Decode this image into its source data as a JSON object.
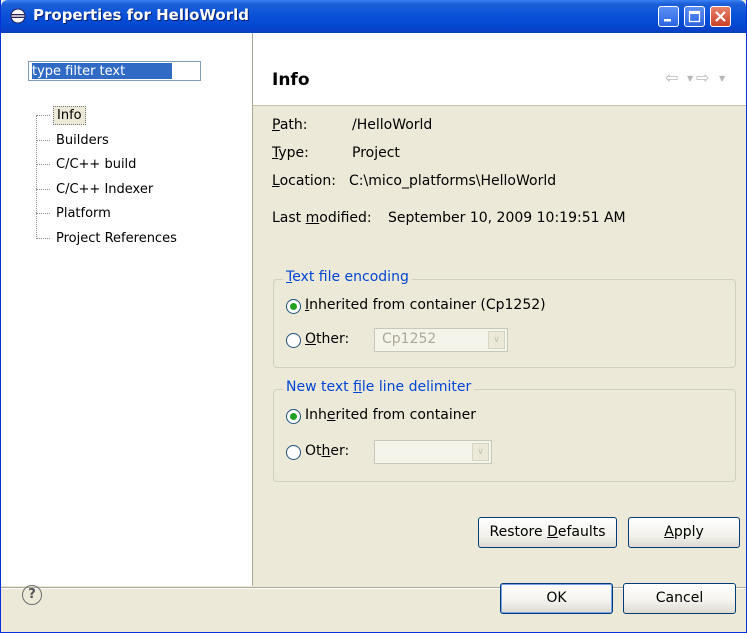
{
  "window": {
    "title": "Properties for HelloWorld",
    "title_icon": "eclipse-icon"
  },
  "sidebar": {
    "filter_value": "type filter text",
    "items": [
      {
        "label": "Info",
        "selected": true
      },
      {
        "label": "Builders"
      },
      {
        "label": "C/C++ build"
      },
      {
        "label": "C/C++ Indexer"
      },
      {
        "label": "Platform"
      },
      {
        "label": "Project References"
      }
    ]
  },
  "page": {
    "title": "Info",
    "nav": {
      "back_icon": "back-arrow-icon",
      "forward_icon": "forward-arrow-icon"
    },
    "path": {
      "label_u": "P",
      "label_rest": "ath:",
      "value": "/HelloWorld"
    },
    "type": {
      "label_u": "T",
      "label_rest": "ype:",
      "value": "Project"
    },
    "location": {
      "label_u": "L",
      "label_rest": "ocation:",
      "value": "C:\\mico_platforms\\HelloWorld"
    },
    "last_modified": {
      "label_pre": "Last ",
      "label_u": "m",
      "label_rest": "odified:",
      "value": "September 10, 2009 10:19:51 AM"
    }
  },
  "encoding": {
    "legend_u": "T",
    "legend_rest": "ext file encoding",
    "inherited_u": "I",
    "inherited_rest": "nherited from container (Cp1252)",
    "other_u": "O",
    "other_rest": "ther:",
    "other_value": "Cp1252",
    "selected": "inherited"
  },
  "delimiter": {
    "legend_pre": "New text ",
    "legend_u": "f",
    "legend_rest": "ile line delimiter",
    "inherited_pre": "Inh",
    "inherited_u": "e",
    "inherited_rest": "rited from container",
    "other_pre": "Ot",
    "other_u": "h",
    "other_rest": "er:",
    "other_value": "",
    "selected": "inherited"
  },
  "buttons": {
    "restore_pre": "Restore ",
    "restore_u": "D",
    "restore_rest": "efaults",
    "apply_u": "A",
    "apply_rest": "pply",
    "ok": "OK",
    "cancel": "Cancel"
  },
  "colors": {
    "titlebar": "#0a52d8",
    "group_legend": "#0046d5",
    "radio_on": "#21a121",
    "selection": "#316ac5"
  }
}
